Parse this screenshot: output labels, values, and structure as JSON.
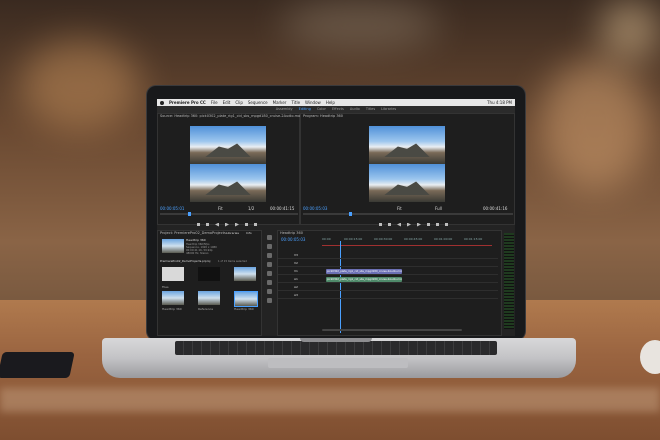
{
  "app": {
    "name": "Premiere Pro CC",
    "menu": [
      "File",
      "Edit",
      "Clip",
      "Sequence",
      "Marker",
      "Title",
      "Window",
      "Help"
    ],
    "status": "Thu 4:18 PM"
  },
  "workspaces": [
    "Assembly",
    "Editing",
    "Color",
    "Effects",
    "Audio",
    "Titles",
    "Libraries"
  ],
  "active_workspace": "Editing",
  "source_monitor": {
    "title": "Source: Headtrip 360: pick0302_plate_rig1_cid_sbs_mpgd180_cruise-2Audio.mov: 00:00:00:00",
    "timecode_in": "00:00:05:01",
    "timecode_out": "00:00:41:15",
    "fit": "Fit",
    "ratio": "1/2"
  },
  "program_monitor": {
    "title": "Program: Headtrip 360",
    "timecode_in": "00:00:05:03",
    "timecode_out": "00:00:41:16",
    "fit": "Fit",
    "ratio": "Full"
  },
  "project_panel": {
    "title": "Project: PremierePro02_DemoProjects",
    "tabs": [
      "Libraries",
      "Info"
    ],
    "file": "PremierePro02_DemoProjects.prproj",
    "item_count": "1 of 15 items selected",
    "clip_name": "Headtrip 360",
    "clip_meta": [
      "Headtrip 360/5fps",
      "Sequence, 1920 x 1080",
      "00:00:41:16, 59.94p",
      "48000 Hz, Stereo"
    ],
    "bins": [
      "Files",
      "Headtrip 360",
      "Reference",
      "Headtrip 360"
    ]
  },
  "timeline": {
    "title": "Headtrip 360",
    "timecode": "00:00:05:03",
    "ruler": [
      "00:00",
      "00:00:15:00",
      "00:00:30:00",
      "00:00:45:00",
      "00:01:00:00",
      "00:01:15:00"
    ],
    "tracks": [
      "V3",
      "V2",
      "V1",
      "A1",
      "A2",
      "A3"
    ],
    "clips": [
      {
        "label": "pick0302_plate_rig1_cid_sbs_mpgd180_cruise-2Audio.mov [V]",
        "track": "V1",
        "color": "#6b6fb4"
      },
      {
        "label": "pick0302_plate_rig1_cid_sbs_mpgd180_cruise-2Audio.mov [A]",
        "track": "A1",
        "color": "#4f8a6a"
      }
    ]
  }
}
